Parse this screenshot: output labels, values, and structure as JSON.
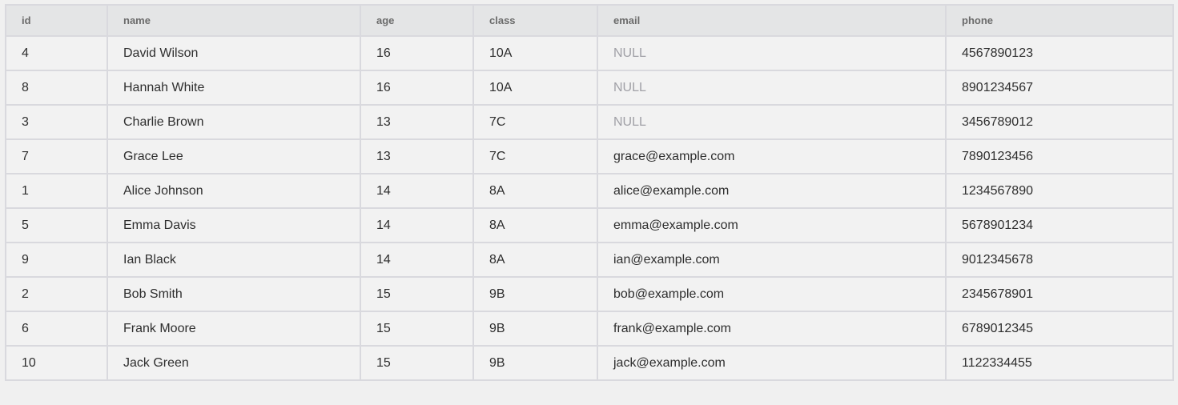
{
  "columns": [
    "id",
    "name",
    "age",
    "class",
    "email",
    "phone"
  ],
  "rows": [
    {
      "id": "4",
      "name": "David Wilson",
      "age": "16",
      "class": "10A",
      "email": "NULL",
      "phone": "4567890123"
    },
    {
      "id": "8",
      "name": "Hannah White",
      "age": "16",
      "class": "10A",
      "email": "NULL",
      "phone": "8901234567"
    },
    {
      "id": "3",
      "name": "Charlie Brown",
      "age": "13",
      "class": "7C",
      "email": "NULL",
      "phone": "3456789012"
    },
    {
      "id": "7",
      "name": "Grace Lee",
      "age": "13",
      "class": "7C",
      "email": "grace@example.com",
      "phone": "7890123456"
    },
    {
      "id": "1",
      "name": "Alice Johnson",
      "age": "14",
      "class": "8A",
      "email": "alice@example.com",
      "phone": "1234567890"
    },
    {
      "id": "5",
      "name": "Emma Davis",
      "age": "14",
      "class": "8A",
      "email": "emma@example.com",
      "phone": "5678901234"
    },
    {
      "id": "9",
      "name": "Ian Black",
      "age": "14",
      "class": "8A",
      "email": "ian@example.com",
      "phone": "9012345678"
    },
    {
      "id": "2",
      "name": "Bob Smith",
      "age": "15",
      "class": "9B",
      "email": "bob@example.com",
      "phone": "2345678901"
    },
    {
      "id": "6",
      "name": "Frank Moore",
      "age": "15",
      "class": "9B",
      "email": "frank@example.com",
      "phone": "6789012345"
    },
    {
      "id": "10",
      "name": "Jack Green",
      "age": "15",
      "class": "9B",
      "email": "jack@example.com",
      "phone": "1122334455"
    }
  ],
  "null_text": "NULL",
  "colors": {
    "header_bg": "#e4e5e6",
    "cell_bg": "#f2f2f2",
    "border": "#d9d9de",
    "null_text": "#a0a0a6"
  }
}
